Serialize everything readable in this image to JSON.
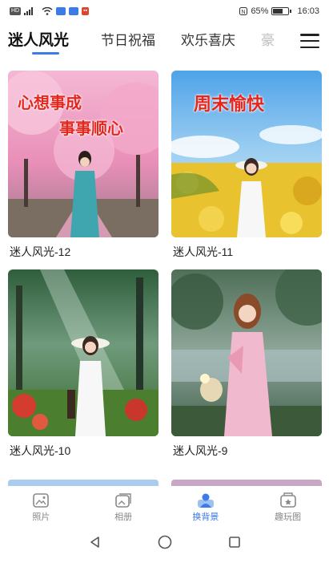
{
  "status": {
    "battery": "65%",
    "time": "16:03",
    "battery_level": 0.65
  },
  "tabs": [
    {
      "label": "迷人风光",
      "active": true
    },
    {
      "label": "节日祝福",
      "active": false
    },
    {
      "label": "欢乐喜庆",
      "active": false
    },
    {
      "label": "豪",
      "active": false
    }
  ],
  "cards": [
    {
      "title": "迷人风光-12",
      "overlay": [
        "心想事成",
        "事事顺心"
      ]
    },
    {
      "title": "迷人风光-11",
      "overlay": [
        "周末愉快"
      ]
    },
    {
      "title": "迷人风光-10",
      "overlay": []
    },
    {
      "title": "迷人风光-9",
      "overlay": []
    }
  ],
  "bottom_nav": [
    {
      "label": "照片",
      "icon": "photo-icon",
      "active": false
    },
    {
      "label": "相册",
      "icon": "album-icon",
      "active": false
    },
    {
      "label": "换背景",
      "icon": "change-background-icon",
      "active": true
    },
    {
      "label": "趣玩图",
      "icon": "fun-image-icon",
      "active": false
    }
  ],
  "colors": {
    "accent": "#3d7be8",
    "overlay_text": "#e8251c"
  }
}
